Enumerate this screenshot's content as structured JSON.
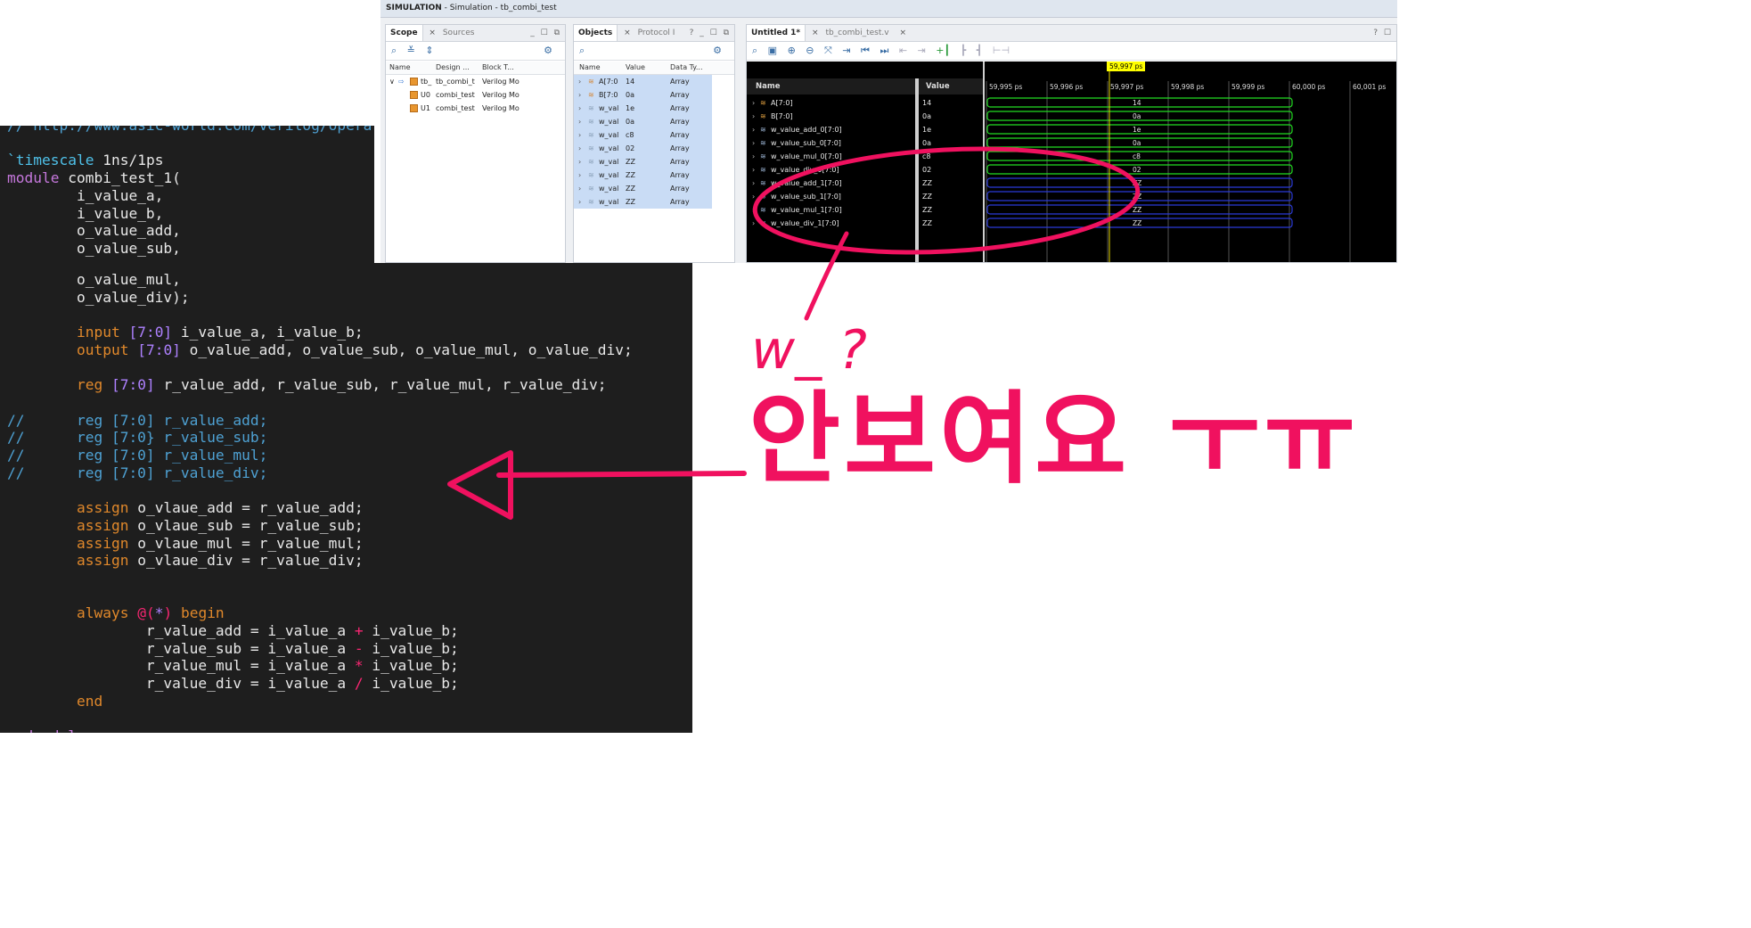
{
  "window": {
    "title_bold": "SIMULATION",
    "title_rest": " - Simulation - tb_combi_test"
  },
  "scope_panel": {
    "tabs": [
      "Scope",
      "Sources"
    ],
    "controls": "_ ☐ ⧉",
    "columns": [
      "Name",
      "Design ...",
      "Block T..."
    ],
    "rows": [
      {
        "expander": "∨",
        "name": "tb_",
        "design": "tb_combi_t",
        "block": "Verilog Mo"
      },
      {
        "expander": "",
        "name": "U0",
        "design": "combi_test",
        "block": "Verilog Mo"
      },
      {
        "expander": "",
        "name": "U1",
        "design": "combi_test",
        "block": "Verilog Mo"
      }
    ]
  },
  "objects_panel": {
    "tabs": [
      "Objects",
      "Protocol I"
    ],
    "controls": "? _ ☐ ⧉",
    "columns": [
      "Name",
      "Value",
      "Data Ty..."
    ],
    "rows": [
      {
        "name": "A[7:0",
        "value": "14",
        "type": "Array"
      },
      {
        "name": "B[7:0",
        "value": "0a",
        "type": "Array"
      },
      {
        "name": "w_val",
        "value": "1e",
        "type": "Array"
      },
      {
        "name": "w_val",
        "value": "0a",
        "type": "Array"
      },
      {
        "name": "w_val",
        "value": "c8",
        "type": "Array"
      },
      {
        "name": "w_val",
        "value": "02",
        "type": "Array"
      },
      {
        "name": "w_val",
        "value": "ZZ",
        "type": "Array"
      },
      {
        "name": "w_val",
        "value": "ZZ",
        "type": "Array"
      },
      {
        "name": "w_val",
        "value": "ZZ",
        "type": "Array"
      },
      {
        "name": "w_val",
        "value": "ZZ",
        "type": "Array"
      }
    ]
  },
  "wave_panel": {
    "tabs": [
      "Untitled 1*",
      "tb_combi_test.v"
    ],
    "controls": "? ☐",
    "cursor_time": "59,997 ps",
    "name_header": "Name",
    "value_header": "Value",
    "time_ticks": [
      "59,995 ps",
      "59,996 ps",
      "59,997 ps",
      "59,998 ps",
      "59,999 ps",
      "60,000 ps",
      "60,001 ps"
    ],
    "signals": [
      {
        "name": "A[7:0]",
        "value": "14",
        "state": "valid"
      },
      {
        "name": "B[7:0]",
        "value": "0a",
        "state": "valid"
      },
      {
        "name": "w_value_add_0[7:0]",
        "value": "1e",
        "state": "valid"
      },
      {
        "name": "w_value_sub_0[7:0]",
        "value": "0a",
        "state": "valid"
      },
      {
        "name": "w_value_mul_0[7:0]",
        "value": "c8",
        "state": "valid"
      },
      {
        "name": "w_value_div_0[7:0]",
        "value": "02",
        "state": "valid"
      },
      {
        "name": "w_value_add_1[7:0]",
        "value": "ZZ",
        "state": "highz"
      },
      {
        "name": "w_value_sub_1[7:0]",
        "value": "ZZ",
        "state": "highz"
      },
      {
        "name": "w_value_mul_1[7:0]",
        "value": "ZZ",
        "state": "highz"
      },
      {
        "name": "w_value_div_1[7:0]",
        "value": "ZZ",
        "state": "highz"
      }
    ]
  },
  "code_top": {
    "lines": [
      {
        "t": "// http://www.asic-world.com/verilog/opera",
        "c": "cmt"
      },
      {
        "t": "",
        "c": ""
      },
      {
        "t": "`timescale 1ns/1ps",
        "c": "timescale"
      },
      {
        "t": "module combi_test_1(",
        "c": "module"
      },
      {
        "t": "        i_value_a,",
        "c": ""
      },
      {
        "t": "        i_value_b,",
        "c": ""
      },
      {
        "t": "        o_value_add,",
        "c": ""
      },
      {
        "t": "        o_value_sub,",
        "c": ""
      }
    ]
  },
  "code_main": {
    "lines": [
      "        o_value_mul,",
      "        o_value_div);",
      "",
      "        input [7:0] i_value_a, i_value_b;",
      "        output [7:0] o_value_add, o_value_sub, o_value_mul, o_value_div;",
      "",
      "        reg [7:0] r_value_add, r_value_sub, r_value_mul, r_value_div;",
      "",
      "//      reg [7:0] r_value_add;",
      "//      reg [7:0} r_value_sub;",
      "//      reg [7:0] r_value_mul;",
      "//      reg [7:0] r_value_div;",
      "",
      "        assign o_vlaue_add = r_value_add;",
      "        assign o_vlaue_sub = r_value_sub;",
      "        assign o_vlaue_mul = r_value_mul;",
      "        assign o_vlaue_div = r_value_div;",
      "",
      "",
      "        always @(*) begin",
      "                r_value_add = i_value_a + i_value_b;",
      "                r_value_sub = i_value_a - i_value_b;",
      "                r_value_mul = i_value_a * i_value_b;",
      "                r_value_div = i_value_a / i_value_b;",
      "        end",
      "",
      "endmodule"
    ]
  },
  "annotation": {
    "question": "w_ ?",
    "text": "안보여요 ㅜㅠ",
    "color": "#f0115f"
  },
  "colors": {
    "editor_bg": "#1e1e1e",
    "wave_valid": "#22dd22",
    "wave_highz": "#2b3bd8",
    "selection": "#c9dcf5"
  }
}
